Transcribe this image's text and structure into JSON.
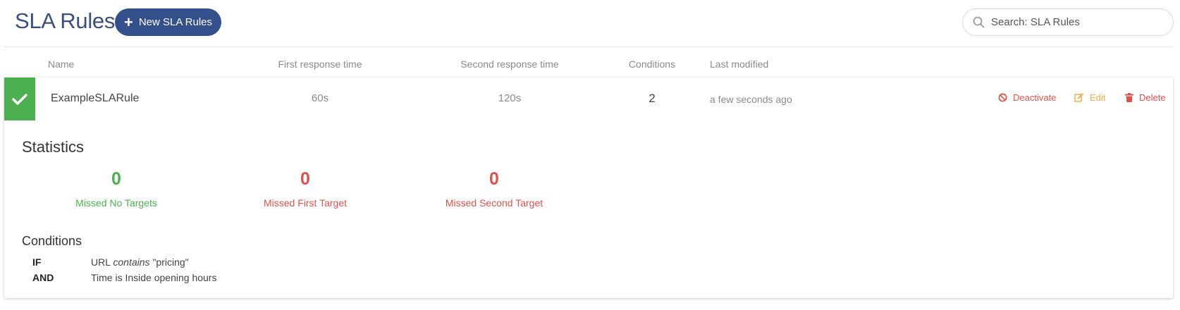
{
  "header": {
    "title": "SLA Rules",
    "new_button_label": "New SLA Rules",
    "search_placeholder": "Search: SLA Rules"
  },
  "table": {
    "columns": [
      "Name",
      "First response time",
      "Second response time",
      "Conditions",
      "Last modified"
    ]
  },
  "rule": {
    "status": "active",
    "name": "ExampleSLARule",
    "first_response": "60s",
    "second_response": "120s",
    "conditions_count": "2",
    "last_modified": "a few seconds ago",
    "actions": {
      "deactivate": "Deactivate",
      "edit": "Edit",
      "delete": "Delete"
    }
  },
  "statistics": {
    "title": "Statistics",
    "items": [
      {
        "value": "0",
        "label": "Missed No Targets"
      },
      {
        "value": "0",
        "label": "Missed First Target"
      },
      {
        "value": "0",
        "label": "Missed Second Target"
      }
    ]
  },
  "conditions": {
    "title": "Conditions",
    "rows": [
      {
        "keyword": "IF",
        "field": "URL",
        "operator": "contains",
        "value": "\"pricing\""
      },
      {
        "keyword": "AND",
        "text": "Time is Inside opening hours"
      }
    ]
  },
  "colors": {
    "primary": "#34508a",
    "success": "#4caf50",
    "danger": "#d9534f",
    "warning": "#f0ad4e"
  },
  "icons": [
    "plus-icon",
    "search-icon",
    "check-icon",
    "ban-icon",
    "edit-icon",
    "trash-icon"
  ]
}
